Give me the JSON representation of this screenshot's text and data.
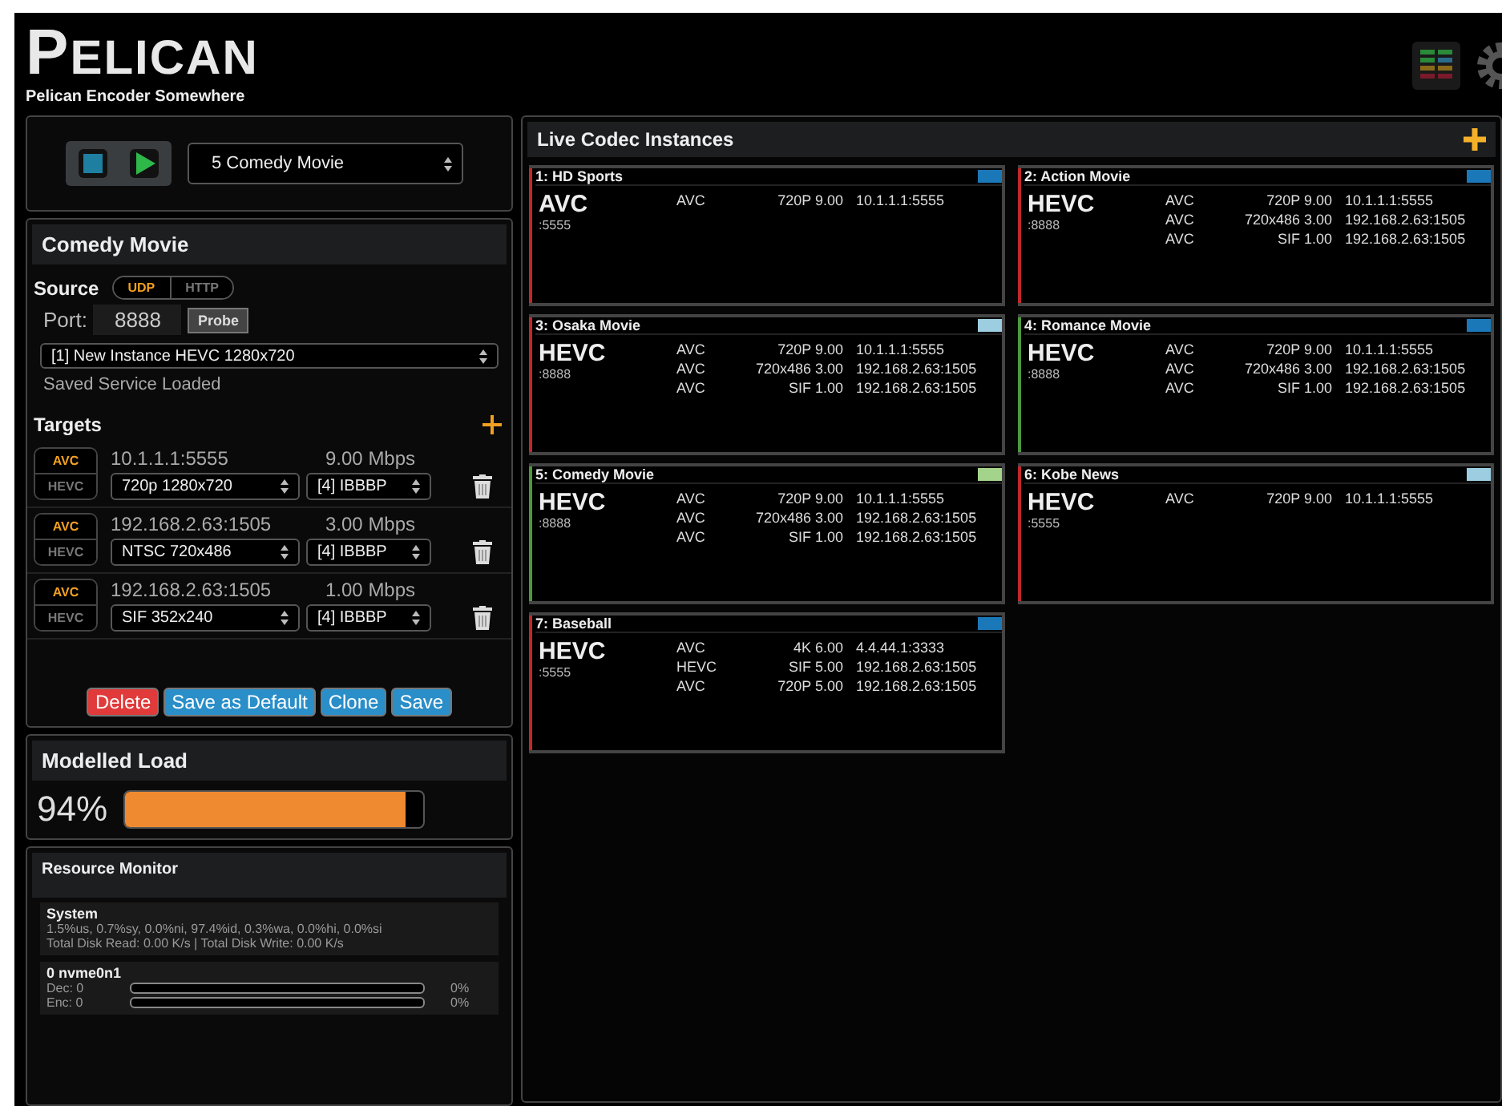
{
  "header": {
    "logo": "PELICAN",
    "subtitle": "Pelican Encoder Somewhere"
  },
  "player": {
    "selected_instance": "5 Comedy Movie"
  },
  "editor": {
    "title": "Comedy Movie",
    "source_label": "Source",
    "source_modes": [
      {
        "label": "UDP",
        "selected": true
      },
      {
        "label": "HTTP",
        "selected": false
      }
    ],
    "port_label": "Port:",
    "port": "8888",
    "probe": "Probe",
    "service": "[1] New Instance HEVC 1280x720",
    "status": "Saved Service Loaded",
    "targets_label": "Targets",
    "targets": [
      {
        "codecs": [
          {
            "label": "AVC",
            "selected": true
          },
          {
            "label": "HEVC",
            "selected": false
          }
        ],
        "address": "10.1.1.1:5555",
        "rate": "9.00 Mbps",
        "resolution": "720p 1280x720",
        "gop": "[4] IBBBP"
      },
      {
        "codecs": [
          {
            "label": "AVC",
            "selected": true
          },
          {
            "label": "HEVC",
            "selected": false
          }
        ],
        "address": "192.168.2.63:1505",
        "rate": "3.00 Mbps",
        "resolution": "NTSC 720x486",
        "gop": "[4] IBBBP"
      },
      {
        "codecs": [
          {
            "label": "AVC",
            "selected": true
          },
          {
            "label": "HEVC",
            "selected": false
          }
        ],
        "address": "192.168.2.63:1505",
        "rate": "1.00 Mbps",
        "resolution": "SIF 352x240",
        "gop": "[4] IBBBP"
      }
    ],
    "buttons": [
      {
        "label": "Delete",
        "kind": "danger"
      },
      {
        "label": "Save as Default",
        "kind": "primary"
      },
      {
        "label": "Clone",
        "kind": "primary"
      },
      {
        "label": "Save",
        "kind": "primary"
      }
    ]
  },
  "load": {
    "title": "Modelled Load",
    "reading": "94%",
    "level": 0.94
  },
  "monitor": {
    "title": "Resource Monitor",
    "system_title": "System",
    "cpu": "1.5%us, 0.7%sy, 0.0%ni, 97.4%id, 0.3%wa, 0.0%hi, 0.0%si",
    "disk": "Total Disk Read: 0.00 K/s | Total Disk Write: 0.00 K/s",
    "device": "0 nvme0n1",
    "meters": [
      {
        "label": "Dec: 0",
        "reading": "0%"
      },
      {
        "label": "Enc: 0",
        "reading": "0%"
      }
    ]
  },
  "live": {
    "title": "Live Codec Instances",
    "instances": [
      {
        "title": "1: HD Sports",
        "color": "#1a78b8",
        "running": false,
        "codec": "AVC",
        "port": ":5555",
        "streams": [
          {
            "codec": "AVC",
            "profile": "720P 9.00",
            "address": "10.1.1.1:5555"
          }
        ]
      },
      {
        "title": "2: Action Movie",
        "color": "#1a78b8",
        "running": false,
        "codec": "HEVC",
        "port": ":8888",
        "streams": [
          {
            "codec": "AVC",
            "profile": "720P 9.00",
            "address": "10.1.1.1:5555"
          },
          {
            "codec": "AVC",
            "profile": "720x486 3.00",
            "address": "192.168.2.63:1505"
          },
          {
            "codec": "AVC",
            "profile": "SIF 1.00",
            "address": "192.168.2.63:1505"
          }
        ]
      },
      {
        "title": "3: Osaka Movie",
        "color": "#9dcde0",
        "running": false,
        "codec": "HEVC",
        "port": ":8888",
        "streams": [
          {
            "codec": "AVC",
            "profile": "720P 9.00",
            "address": "10.1.1.1:5555"
          },
          {
            "codec": "AVC",
            "profile": "720x486 3.00",
            "address": "192.168.2.63:1505"
          },
          {
            "codec": "AVC",
            "profile": "SIF 1.00",
            "address": "192.168.2.63:1505"
          }
        ]
      },
      {
        "title": "4: Romance Movie",
        "color": "#1a78b8",
        "running": true,
        "codec": "HEVC",
        "port": ":8888",
        "streams": [
          {
            "codec": "AVC",
            "profile": "720P 9.00",
            "address": "10.1.1.1:5555"
          },
          {
            "codec": "AVC",
            "profile": "720x486 3.00",
            "address": "192.168.2.63:1505"
          },
          {
            "codec": "AVC",
            "profile": "SIF 1.00",
            "address": "192.168.2.63:1505"
          }
        ]
      },
      {
        "title": "5: Comedy Movie",
        "color": "#a4d48c",
        "running": true,
        "codec": "HEVC",
        "port": ":8888",
        "streams": [
          {
            "codec": "AVC",
            "profile": "720P 9.00",
            "address": "10.1.1.1:5555"
          },
          {
            "codec": "AVC",
            "profile": "720x486 3.00",
            "address": "192.168.2.63:1505"
          },
          {
            "codec": "AVC",
            "profile": "SIF 1.00",
            "address": "192.168.2.63:1505"
          }
        ]
      },
      {
        "title": "6: Kobe News",
        "color": "#9dcde0",
        "running": false,
        "codec": "HEVC",
        "port": ":5555",
        "streams": [
          {
            "codec": "AVC",
            "profile": "720P 9.00",
            "address": "10.1.1.1:5555"
          }
        ]
      },
      {
        "title": "7: Baseball",
        "color": "#1a78b8",
        "running": false,
        "codec": "HEVC",
        "port": ":5555",
        "streams": [
          {
            "codec": "AVC",
            "profile": "4K 6.00",
            "address": "4.4.44.1:3333"
          },
          {
            "codec": "HEVC",
            "profile": "SIF 5.00",
            "address": "192.168.2.63:1505"
          },
          {
            "codec": "AVC",
            "profile": "720P 5.00",
            "address": "192.168.2.63:1505"
          }
        ]
      }
    ]
  }
}
